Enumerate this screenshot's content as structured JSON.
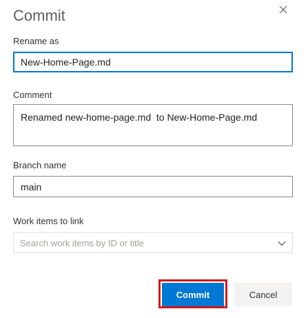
{
  "dialog": {
    "title": "Commit",
    "close_icon": "close-icon"
  },
  "rename": {
    "label": "Rename as",
    "value": "New-Home-Page.md"
  },
  "comment": {
    "label": "Comment",
    "value": "Renamed new-home-page.md  to New-Home-Page.md"
  },
  "branch": {
    "label": "Branch name",
    "value": "main"
  },
  "work_items": {
    "label": "Work items to link",
    "placeholder": "Search work items by ID or title",
    "icon": "chevron-down-icon"
  },
  "buttons": {
    "commit": "Commit",
    "cancel": "Cancel"
  },
  "colors": {
    "primary": "#0078d4",
    "highlight_border": "#d0191c",
    "secondary_bg": "#f3f2f1"
  }
}
